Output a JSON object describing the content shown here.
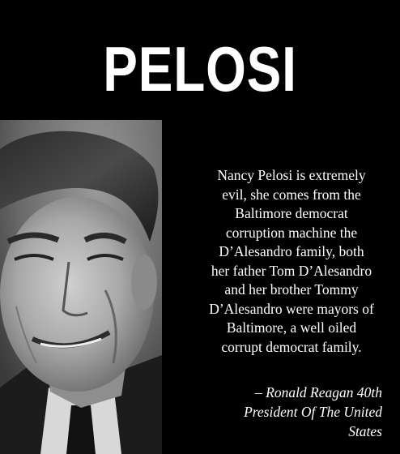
{
  "headline": "PELOSI",
  "quote_lines": [
    "Nancy Pelosi is extremely",
    "evil, she comes from the",
    "Baltimore democrat",
    "corruption machine the",
    "D’Alesandro family, both",
    "her father Tom D’Alesandro",
    "and her brother Tommy",
    "D’Alesandro were mayors of",
    "Baltimore, a well oiled",
    "corrupt democrat family."
  ],
  "attribution_lines": [
    "– Ronald Reagan 40th",
    "President Of The United",
    "States"
  ],
  "colors": {
    "background": "#000000",
    "text": "#ffffff"
  }
}
